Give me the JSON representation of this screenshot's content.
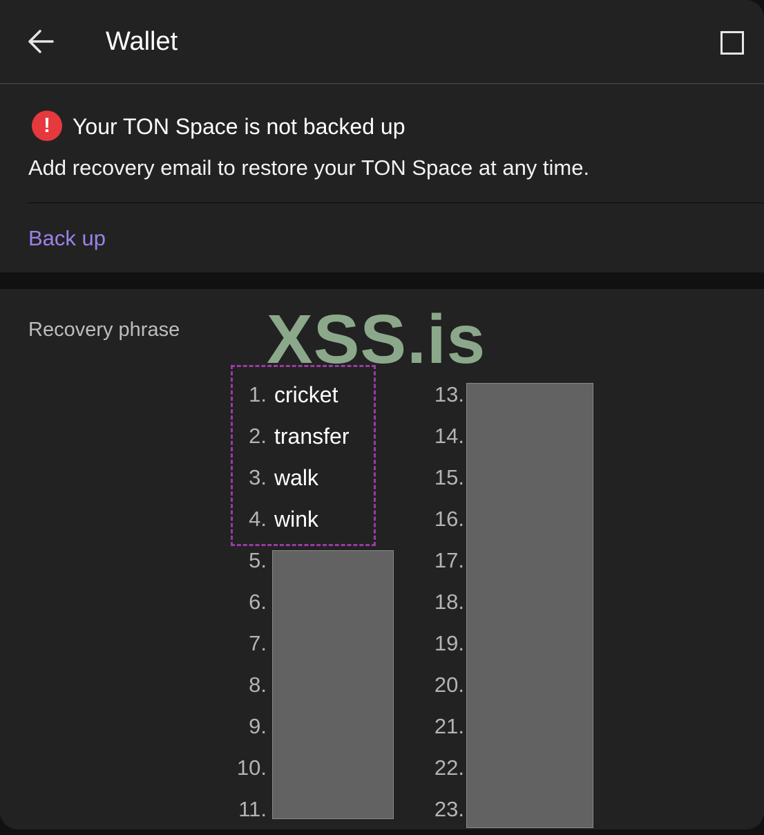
{
  "header": {
    "title": "Wallet",
    "back_icon": "arrow-left-icon",
    "maximize_icon": "maximize-square-icon"
  },
  "banner": {
    "alert_icon": "exclamation-circle-icon",
    "alert_glyph": "!",
    "title": "Your TON Space is not backed up",
    "text": "Add recovery email to restore your TON Space at any time.",
    "action_label": "Back up",
    "accent_color": "#9b82e8",
    "alert_color": "#e5393d"
  },
  "recovery": {
    "label": "Recovery phrase",
    "watermark": "XSS.is",
    "left_column": [
      {
        "num": "1.",
        "word": "cricket"
      },
      {
        "num": "2.",
        "word": "transfer"
      },
      {
        "num": "3.",
        "word": "walk"
      },
      {
        "num": "4.",
        "word": "wink"
      },
      {
        "num": "5.",
        "word": ""
      },
      {
        "num": "6.",
        "word": ""
      },
      {
        "num": "7.",
        "word": ""
      },
      {
        "num": "8.",
        "word": ""
      },
      {
        "num": "9.",
        "word": ""
      },
      {
        "num": "10.",
        "word": ""
      },
      {
        "num": "11.",
        "word": ""
      }
    ],
    "right_column": [
      {
        "num": "13.",
        "word": ""
      },
      {
        "num": "14.",
        "word": ""
      },
      {
        "num": "15.",
        "word": ""
      },
      {
        "num": "16.",
        "word": ""
      },
      {
        "num": "17.",
        "word": ""
      },
      {
        "num": "18.",
        "word": ""
      },
      {
        "num": "19.",
        "word": ""
      },
      {
        "num": "20.",
        "word": ""
      },
      {
        "num": "21.",
        "word": ""
      },
      {
        "num": "22.",
        "word": ""
      },
      {
        "num": "23.",
        "word": ""
      }
    ]
  }
}
